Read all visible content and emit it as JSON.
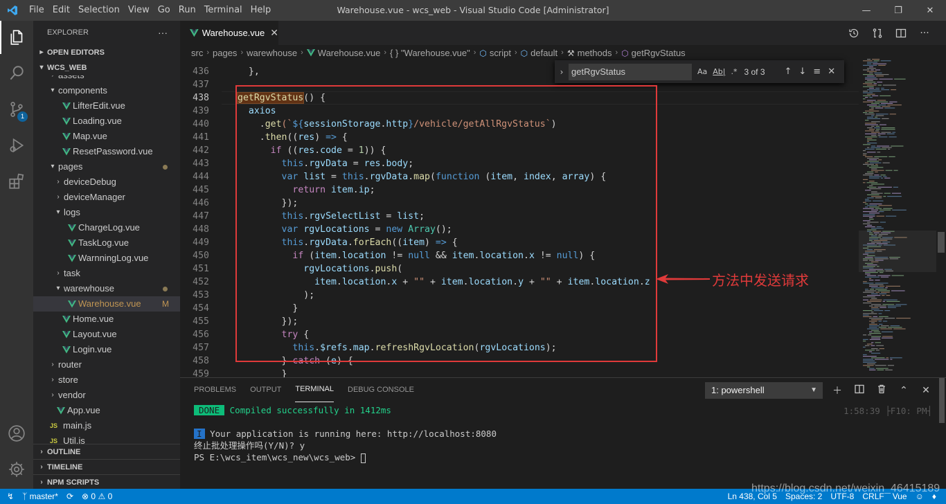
{
  "menu": [
    "File",
    "Edit",
    "Selection",
    "View",
    "Go",
    "Run",
    "Terminal",
    "Help"
  ],
  "window_title": "Warehouse.vue - wcs_web - Visual Studio Code [Administrator]",
  "window_controls": {
    "minimize": "—",
    "restore": "❐",
    "close": "✕"
  },
  "activity": {
    "scm_badge": "1"
  },
  "explorer": {
    "title": "EXPLORER",
    "more": "···",
    "open_editors": "OPEN EDITORS",
    "root": "WCS_WEB",
    "tree": [
      {
        "label": "assets",
        "indent": 1,
        "kind": "folder-closed",
        "clip": true
      },
      {
        "label": "components",
        "indent": 1,
        "kind": "folder-open"
      },
      {
        "label": "LifterEdit.vue",
        "indent": 2,
        "kind": "vue"
      },
      {
        "label": "Loading.vue",
        "indent": 2,
        "kind": "vue"
      },
      {
        "label": "Map.vue",
        "indent": 2,
        "kind": "vue"
      },
      {
        "label": "ResetPassword.vue",
        "indent": 2,
        "kind": "vue"
      },
      {
        "label": "pages",
        "indent": 1,
        "kind": "folder-open",
        "dot": true,
        "color": "#c09553"
      },
      {
        "label": "deviceDebug",
        "indent": 2,
        "kind": "folder-closed"
      },
      {
        "label": "deviceManager",
        "indent": 2,
        "kind": "folder-closed"
      },
      {
        "label": "logs",
        "indent": 2,
        "kind": "folder-open"
      },
      {
        "label": "ChargeLog.vue",
        "indent": 3,
        "kind": "vue"
      },
      {
        "label": "TaskLog.vue",
        "indent": 3,
        "kind": "vue"
      },
      {
        "label": "WarnningLog.vue",
        "indent": 3,
        "kind": "vue"
      },
      {
        "label": "task",
        "indent": 2,
        "kind": "folder-closed"
      },
      {
        "label": "warewhouse",
        "indent": 2,
        "kind": "folder-open",
        "dot": true,
        "color": "#c09553"
      },
      {
        "label": "Warehouse.vue",
        "indent": 3,
        "kind": "vue",
        "active": true,
        "mod": "M",
        "color": "#c09553"
      },
      {
        "label": "Home.vue",
        "indent": 2,
        "kind": "vue"
      },
      {
        "label": "Layout.vue",
        "indent": 2,
        "kind": "vue"
      },
      {
        "label": "Login.vue",
        "indent": 2,
        "kind": "vue"
      },
      {
        "label": "router",
        "indent": 1,
        "kind": "folder-closed"
      },
      {
        "label": "store",
        "indent": 1,
        "kind": "folder-closed"
      },
      {
        "label": "vendor",
        "indent": 1,
        "kind": "folder-closed"
      },
      {
        "label": "App.vue",
        "indent": 1,
        "kind": "vue"
      },
      {
        "label": "main.js",
        "indent": 1,
        "kind": "js"
      },
      {
        "label": "Util.js",
        "indent": 1,
        "kind": "js",
        "clip": true
      }
    ],
    "sections": [
      "OUTLINE",
      "TIMELINE",
      "NPM SCRIPTS"
    ]
  },
  "tab": {
    "label": "Warehouse.vue",
    "close": "✕"
  },
  "breadcrumb": [
    "src",
    "pages",
    "warewhouse",
    "Warehouse.vue",
    "{ } \"Warehouse.vue\"",
    "script",
    "default",
    "methods",
    "getRgvStatus"
  ],
  "find": {
    "value": "getRgvStatus",
    "match_case": "Aa",
    "whole_word": "Ab|",
    "regex": ".*",
    "count": "3 of 3"
  },
  "code": {
    "current_line": 438,
    "lines": [
      {
        "n": 436,
        "tokens": [
          [
            "  },",
            "p"
          ]
        ]
      },
      {
        "n": 437,
        "tokens": []
      },
      {
        "n": 438,
        "tokens": [
          [
            "getRgvStatus",
            "hl"
          ],
          [
            "() {",
            "p"
          ]
        ]
      },
      {
        "n": 439,
        "tokens": [
          [
            "  axios",
            "var"
          ]
        ]
      },
      {
        "n": 440,
        "tokens": [
          [
            "    .",
            "p"
          ],
          [
            "get",
            "fn"
          ],
          [
            "(`",
            "str"
          ],
          [
            "${",
            "kw"
          ],
          [
            "sessionStorage",
            "var"
          ],
          [
            ".",
            "p"
          ],
          [
            "http",
            "var"
          ],
          [
            "}",
            "kw"
          ],
          [
            "/vehicle/getAllRgvStatus`",
            "str"
          ],
          [
            ")",
            "p"
          ]
        ]
      },
      {
        "n": 441,
        "tokens": [
          [
            "    .",
            "p"
          ],
          [
            "then",
            "fn"
          ],
          [
            "((",
            "p"
          ],
          [
            "res",
            "var"
          ],
          [
            ") ",
            "p"
          ],
          [
            "=>",
            "kw"
          ],
          [
            " {",
            "p"
          ]
        ]
      },
      {
        "n": 442,
        "tokens": [
          [
            "      ",
            "p"
          ],
          [
            "if",
            "ctl"
          ],
          [
            " ((",
            "p"
          ],
          [
            "res",
            "var"
          ],
          [
            ".",
            "p"
          ],
          [
            "code",
            "var"
          ],
          [
            " = ",
            "p"
          ],
          [
            "1",
            "num"
          ],
          [
            ")) {",
            "p"
          ]
        ]
      },
      {
        "n": 443,
        "tokens": [
          [
            "        ",
            "p"
          ],
          [
            "this",
            "kw"
          ],
          [
            ".",
            "p"
          ],
          [
            "rgvData",
            "var"
          ],
          [
            " = ",
            "p"
          ],
          [
            "res",
            "var"
          ],
          [
            ".",
            "p"
          ],
          [
            "body",
            "var"
          ],
          [
            ";",
            "p"
          ]
        ]
      },
      {
        "n": 444,
        "tokens": [
          [
            "        ",
            "p"
          ],
          [
            "var",
            "kw"
          ],
          [
            " ",
            "p"
          ],
          [
            "list",
            "var"
          ],
          [
            " = ",
            "p"
          ],
          [
            "this",
            "kw"
          ],
          [
            ".",
            "p"
          ],
          [
            "rgvData",
            "var"
          ],
          [
            ".",
            "p"
          ],
          [
            "map",
            "fn"
          ],
          [
            "(",
            "p"
          ],
          [
            "function",
            "kw"
          ],
          [
            " (",
            "p"
          ],
          [
            "item",
            "var"
          ],
          [
            ", ",
            "p"
          ],
          [
            "index",
            "var"
          ],
          [
            ", ",
            "p"
          ],
          [
            "array",
            "var"
          ],
          [
            ") {",
            "p"
          ]
        ]
      },
      {
        "n": 445,
        "tokens": [
          [
            "          ",
            "p"
          ],
          [
            "return",
            "ctl"
          ],
          [
            " ",
            "p"
          ],
          [
            "item",
            "var"
          ],
          [
            ".",
            "p"
          ],
          [
            "ip",
            "var"
          ],
          [
            ";",
            "p"
          ]
        ]
      },
      {
        "n": 446,
        "tokens": [
          [
            "        });",
            "p"
          ]
        ]
      },
      {
        "n": 447,
        "tokens": [
          [
            "        ",
            "p"
          ],
          [
            "this",
            "kw"
          ],
          [
            ".",
            "p"
          ],
          [
            "rgvSelectList",
            "var"
          ],
          [
            " = ",
            "p"
          ],
          [
            "list",
            "var"
          ],
          [
            ";",
            "p"
          ]
        ]
      },
      {
        "n": 448,
        "tokens": [
          [
            "        ",
            "p"
          ],
          [
            "var",
            "kw"
          ],
          [
            " ",
            "p"
          ],
          [
            "rgvLocations",
            "var"
          ],
          [
            " = ",
            "p"
          ],
          [
            "new",
            "kw"
          ],
          [
            " ",
            "p"
          ],
          [
            "Array",
            "cls"
          ],
          [
            "();",
            "p"
          ]
        ]
      },
      {
        "n": 449,
        "tokens": [
          [
            "        ",
            "p"
          ],
          [
            "this",
            "kw"
          ],
          [
            ".",
            "p"
          ],
          [
            "rgvData",
            "var"
          ],
          [
            ".",
            "p"
          ],
          [
            "forEach",
            "fn"
          ],
          [
            "((",
            "p"
          ],
          [
            "item",
            "var"
          ],
          [
            ") ",
            "p"
          ],
          [
            "=>",
            "kw"
          ],
          [
            " {",
            "p"
          ]
        ]
      },
      {
        "n": 450,
        "tokens": [
          [
            "          ",
            "p"
          ],
          [
            "if",
            "ctl"
          ],
          [
            " (",
            "p"
          ],
          [
            "item",
            "var"
          ],
          [
            ".",
            "p"
          ],
          [
            "location",
            "var"
          ],
          [
            " != ",
            "p"
          ],
          [
            "null",
            "kw"
          ],
          [
            " && ",
            "p"
          ],
          [
            "item",
            "var"
          ],
          [
            ".",
            "p"
          ],
          [
            "location",
            "var"
          ],
          [
            ".",
            "p"
          ],
          [
            "x",
            "var"
          ],
          [
            " != ",
            "p"
          ],
          [
            "null",
            "kw"
          ],
          [
            ") {",
            "p"
          ]
        ]
      },
      {
        "n": 451,
        "tokens": [
          [
            "            ",
            "p"
          ],
          [
            "rgvLocations",
            "var"
          ],
          [
            ".",
            "p"
          ],
          [
            "push",
            "fn"
          ],
          [
            "(",
            "p"
          ]
        ]
      },
      {
        "n": 452,
        "tokens": [
          [
            "              ",
            "p"
          ],
          [
            "item",
            "var"
          ],
          [
            ".",
            "p"
          ],
          [
            "location",
            "var"
          ],
          [
            ".",
            "p"
          ],
          [
            "x",
            "var"
          ],
          [
            " + ",
            "p"
          ],
          [
            "\"\"",
            "str"
          ],
          [
            " + ",
            "p"
          ],
          [
            "item",
            "var"
          ],
          [
            ".",
            "p"
          ],
          [
            "location",
            "var"
          ],
          [
            ".",
            "p"
          ],
          [
            "y",
            "var"
          ],
          [
            " + ",
            "p"
          ],
          [
            "\"\"",
            "str"
          ],
          [
            " + ",
            "p"
          ],
          [
            "item",
            "var"
          ],
          [
            ".",
            "p"
          ],
          [
            "location",
            "var"
          ],
          [
            ".",
            "p"
          ],
          [
            "z",
            "var"
          ]
        ]
      },
      {
        "n": 453,
        "tokens": [
          [
            "            );",
            "p"
          ]
        ]
      },
      {
        "n": 454,
        "tokens": [
          [
            "          }",
            "p"
          ]
        ]
      },
      {
        "n": 455,
        "tokens": [
          [
            "        });",
            "p"
          ]
        ]
      },
      {
        "n": 456,
        "tokens": [
          [
            "        ",
            "p"
          ],
          [
            "try",
            "ctl"
          ],
          [
            " {",
            "p"
          ]
        ]
      },
      {
        "n": 457,
        "tokens": [
          [
            "          ",
            "p"
          ],
          [
            "this",
            "kw"
          ],
          [
            ".",
            "p"
          ],
          [
            "$refs",
            "var"
          ],
          [
            ".",
            "p"
          ],
          [
            "map",
            "var"
          ],
          [
            ".",
            "p"
          ],
          [
            "refreshRgvLocation",
            "fn"
          ],
          [
            "(",
            "p"
          ],
          [
            "rgvLocations",
            "var"
          ],
          [
            ");",
            "p"
          ]
        ]
      },
      {
        "n": 458,
        "tokens": [
          [
            "        } ",
            "p"
          ],
          [
            "catch",
            "ctl"
          ],
          [
            " (",
            "p"
          ],
          [
            "e",
            "var"
          ],
          [
            ") {",
            "p"
          ]
        ]
      },
      {
        "n": 459,
        "tokens": [
          [
            "        }",
            "p"
          ]
        ]
      }
    ]
  },
  "annotation": "方法中发送请求",
  "panel": {
    "tabs": [
      "PROBLEMS",
      "OUTPUT",
      "TERMINAL",
      "DEBUG CONSOLE"
    ],
    "active_tab": "TERMINAL",
    "terminal_select": "1: powershell",
    "done_badge": "DONE",
    "compiled": "Compiled successfully in 1412ms",
    "time": "1:58:39 ├F10: PM┤",
    "info_badge": "I",
    "running": "Your application is running here: http://localhost:8080",
    "terminate": "终止批处理操作吗(Y/N)? y",
    "prompt": "PS E:\\wcs_item\\wcs_new\\wcs_web> "
  },
  "status": {
    "branch": "master*",
    "errors": "0",
    "warnings": "0",
    "position": "Ln 438, Col 5",
    "spaces": "Spaces: 2",
    "encoding": "UTF-8",
    "eol": "CRLF",
    "language": "Vue"
  },
  "watermark": "https://blog.csdn.net/weixin_46415189",
  "colors": {
    "accent": "#007acc",
    "annotation": "#e03a3a",
    "vue": "#41b883"
  }
}
